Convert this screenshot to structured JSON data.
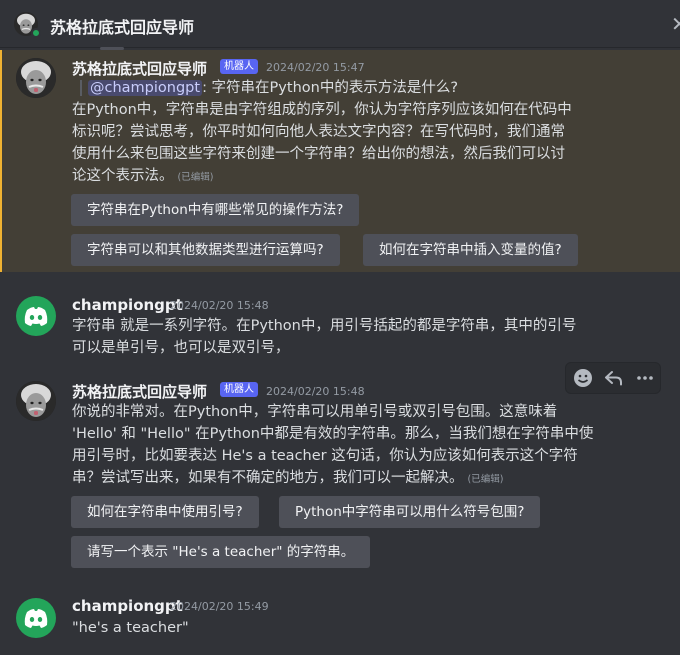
{
  "header": {
    "title": "苏格拉底式回应导师",
    "close_glyph": "✕"
  },
  "messages": [
    {
      "author": "苏格拉底式回应导师",
      "bot_badge": "机器人",
      "timestamp": "2024/02/20 15:47",
      "reply": {
        "mention": "@championgpt",
        "text": ": 字符串在Python中的表示方法是什么?"
      },
      "lines": [
        "在Python中，字符串是由字符组成的序列，你认为字符序列应该如何在代码中",
        "标识呢？尝试思考，你平时如何向他人表达文字内容？在写代码时，我们通常",
        "使用什么来包围这些字符来创建一个字符串？给出你的想法，然后我们可以讨",
        "论这个表示法。"
      ],
      "edited": "(已编辑)",
      "buttons": [
        "字符串在Python中有哪些常见的操作方法?",
        "字符串可以和其他数据类型进行运算吗?",
        "如何在字符串中插入变量的值?"
      ]
    },
    {
      "author": "championgpt",
      "timestamp": "2024/02/20 15:48",
      "lines": [
        "字符串 就是一系列字符。在Python中，用引号括起的都是字符串，其中的引号",
        "可以是单引号，也可以是双引号，"
      ]
    },
    {
      "author": "苏格拉底式回应导师",
      "bot_badge": "机器人",
      "timestamp": "2024/02/20 15:48",
      "lines": [
        "你说的非常对。在Python中，字符串可以用单引号或双引号包围。这意味着",
        "'Hello' 和 \"Hello\" 在Python中都是有效的字符串。那么，当我们想在字符串中使",
        "用引号时，比如要表达 He's a teacher 这句话，你认为应该如何表示这个字符",
        "串？尝试写出来，如果有不确定的地方，我们可以一起解决。"
      ],
      "edited": "(已编辑)",
      "buttons": [
        "如何在字符串中使用引号?",
        "Python中字符串可以用什么符号包围?",
        "请写一个表示 \"He's a teacher\" 的字符串。"
      ]
    },
    {
      "author": "championgpt",
      "timestamp": "2024/02/20 15:49",
      "lines": [
        "\"he's a teacher\""
      ]
    }
  ],
  "hover_actions": [
    "add-reaction",
    "reply",
    "more"
  ],
  "colors": {
    "background": "#313338",
    "highlight": "#433f36",
    "highlight_bar": "#f0b232",
    "button": "#4e5058",
    "bot_badge": "#5865f2",
    "discord_green": "#23a55a"
  }
}
